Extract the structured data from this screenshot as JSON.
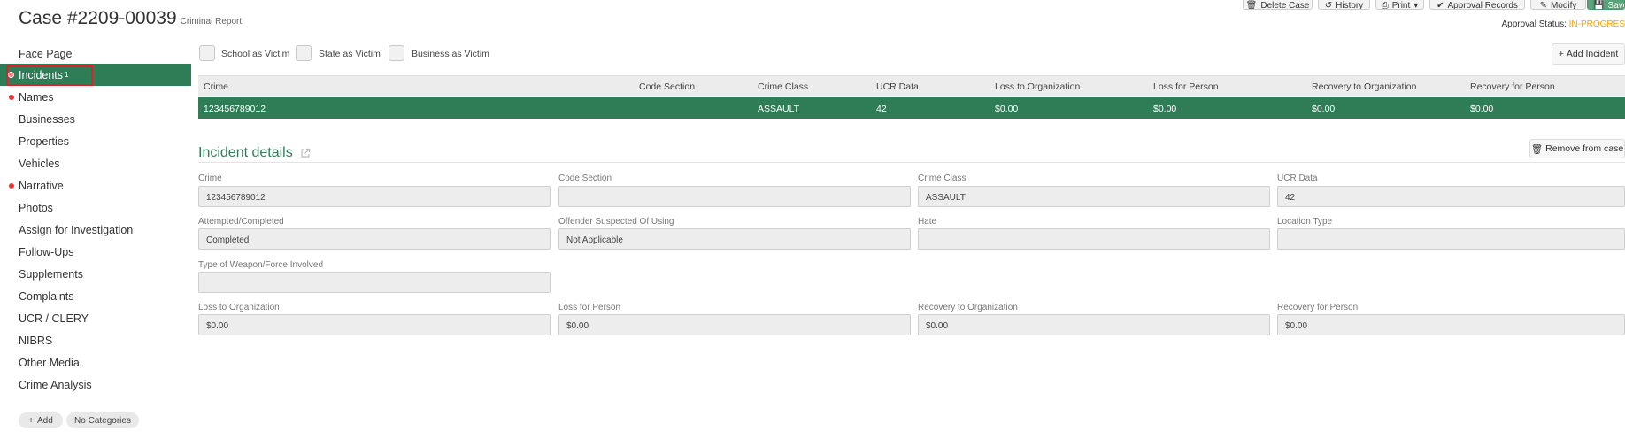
{
  "header": {
    "case_title": "Case #2209-00039",
    "case_subtitle": "Criminal Report",
    "buttons": {
      "delete": "Delete Case",
      "history": "History",
      "print": "Print",
      "approval_records": "Approval Records",
      "modify": "Modify",
      "save": "Save"
    },
    "approval_label": "Approval Status:",
    "approval_status": "IN-PROGRES"
  },
  "sidebar": {
    "items": [
      {
        "label": "Face Page"
      },
      {
        "label": "Incidents",
        "badge": "1"
      },
      {
        "label": "Names"
      },
      {
        "label": "Businesses"
      },
      {
        "label": "Properties"
      },
      {
        "label": "Vehicles"
      },
      {
        "label": "Narrative"
      },
      {
        "label": "Photos"
      },
      {
        "label": "Assign for Investigation"
      },
      {
        "label": "Follow-Ups"
      },
      {
        "label": "Supplements"
      },
      {
        "label": "Complaints"
      },
      {
        "label": "UCR / CLERY"
      },
      {
        "label": "NIBRS"
      },
      {
        "label": "Other Media"
      },
      {
        "label": "Crime Analysis"
      }
    ],
    "add_label": "Add",
    "categories_label": "No Categories"
  },
  "victim_options": {
    "school": "School as Victim",
    "state": "State as Victim",
    "business": "Business as Victim"
  },
  "add_incident_label": "Add Incident",
  "table": {
    "columns": [
      "Crime",
      "Code Section",
      "Crime Class",
      "UCR Data",
      "Loss to Organization",
      "Loss for Person",
      "Recovery to Organization",
      "Recovery for Person"
    ],
    "row": [
      "123456789012",
      "",
      "ASSAULT",
      "42",
      "$0.00",
      "$0.00",
      "$0.00",
      "$0.00"
    ]
  },
  "details": {
    "title": "Incident details",
    "remove_label": "Remove from case",
    "fields": {
      "crime": {
        "label": "Crime",
        "value": "123456789012"
      },
      "code_section": {
        "label": "Code Section",
        "value": ""
      },
      "crime_class": {
        "label": "Crime Class",
        "value": "ASSAULT"
      },
      "ucr_data": {
        "label": "UCR Data",
        "value": "42"
      },
      "attempted": {
        "label": "Attempted/Completed",
        "value": "Completed"
      },
      "offender": {
        "label": "Offender Suspected Of Using",
        "value": "Not Applicable"
      },
      "hate": {
        "label": "Hate",
        "value": ""
      },
      "location": {
        "label": "Location Type",
        "value": ""
      },
      "weapon": {
        "label": "Type of Weapon/Force Involved",
        "value": ""
      },
      "loss_org": {
        "label": "Loss to Organization",
        "value": "$0.00"
      },
      "loss_person": {
        "label": "Loss for Person",
        "value": "$0.00"
      },
      "rec_org": {
        "label": "Recovery to Organization",
        "value": "$0.00"
      },
      "rec_person": {
        "label": "Recovery for Person",
        "value": "$0.00"
      }
    }
  },
  "colors": {
    "accent": "#2e7d57",
    "status": "#f0a500",
    "required_dot": "#e53935",
    "highlight": "#e0202a"
  }
}
